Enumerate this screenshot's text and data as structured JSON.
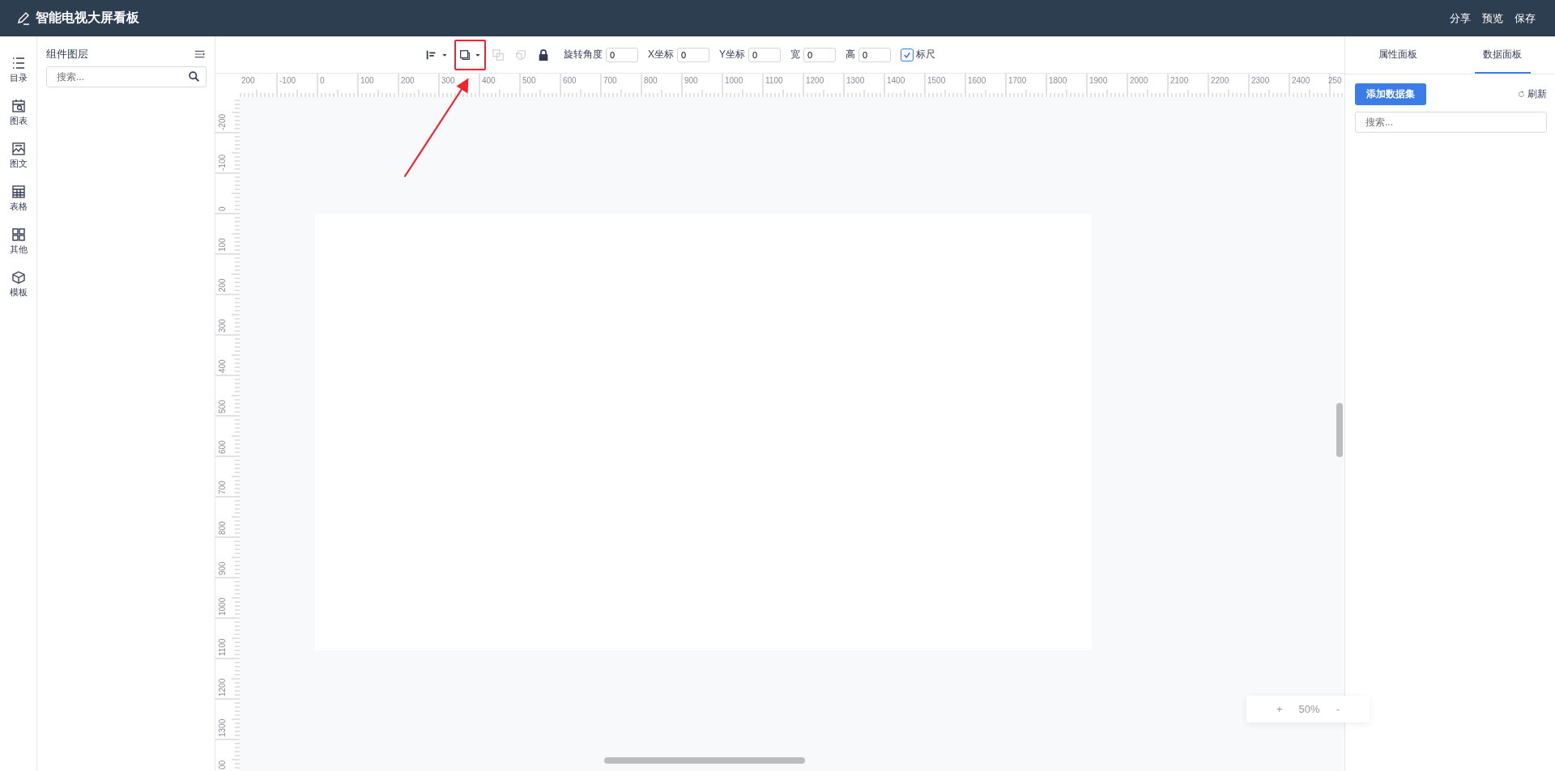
{
  "header": {
    "title": "智能电视大屏看板",
    "actions": [
      "分享",
      "预览",
      "保存"
    ]
  },
  "nav": [
    {
      "label": "目录",
      "kind": "list"
    },
    {
      "label": "图表",
      "kind": "chart"
    },
    {
      "label": "图文",
      "kind": "image"
    },
    {
      "label": "表格",
      "kind": "table"
    },
    {
      "label": "其他",
      "kind": "grid"
    },
    {
      "label": "模板",
      "kind": "cube"
    }
  ],
  "layers_panel": {
    "title": "组件图层",
    "search": {
      "placeholder": "搜索..."
    }
  },
  "toolbar": {
    "tools": [
      {
        "kind": "align",
        "dropdown": true,
        "disabled": false,
        "highlighted": false
      },
      {
        "kind": "layer",
        "dropdown": true,
        "disabled": false,
        "highlighted": true
      },
      {
        "kind": "copy",
        "dropdown": false,
        "disabled": true,
        "highlighted": false
      },
      {
        "kind": "ungroup",
        "dropdown": false,
        "disabled": true,
        "highlighted": false
      },
      {
        "kind": "lock",
        "dropdown": false,
        "disabled": false,
        "highlighted": false
      }
    ],
    "fields": [
      {
        "label": "旋转角度",
        "value": "0"
      },
      {
        "label": "X坐标",
        "value": "0"
      },
      {
        "label": "Y坐标",
        "value": "0"
      },
      {
        "label": "宽",
        "value": "0"
      },
      {
        "label": "高",
        "value": "0"
      }
    ],
    "ruler_toggle": {
      "label": "标尺",
      "checked": true
    }
  },
  "ruler": {
    "x_labels": [
      "200",
      "-100",
      "0",
      "100",
      "200",
      "300",
      "400",
      "500",
      "600",
      "700",
      "800",
      "900",
      "1000",
      "1100",
      "1200",
      "1300",
      "1400",
      "1500",
      "1600",
      "1700",
      "1800",
      "1900",
      "2000",
      "2100",
      "2200",
      "2300",
      "2400",
      "250"
    ],
    "y_labels": [
      "-200",
      "-100",
      "0",
      "100",
      "200",
      "300",
      "400",
      "500",
      "600",
      "700",
      "800",
      "900",
      "1000",
      "1100",
      "1200",
      "1300",
      "00"
    ]
  },
  "zoom": {
    "zoom_in": "+",
    "level": "50%",
    "zoom_out": "-"
  },
  "right_panel": {
    "tabs": [
      {
        "label": "属性面板",
        "selected": false
      },
      {
        "label": "数据面板",
        "selected": true
      }
    ],
    "add_button": "添加数据集",
    "refresh": "刷新",
    "search": {
      "placeholder": "搜索..."
    }
  }
}
